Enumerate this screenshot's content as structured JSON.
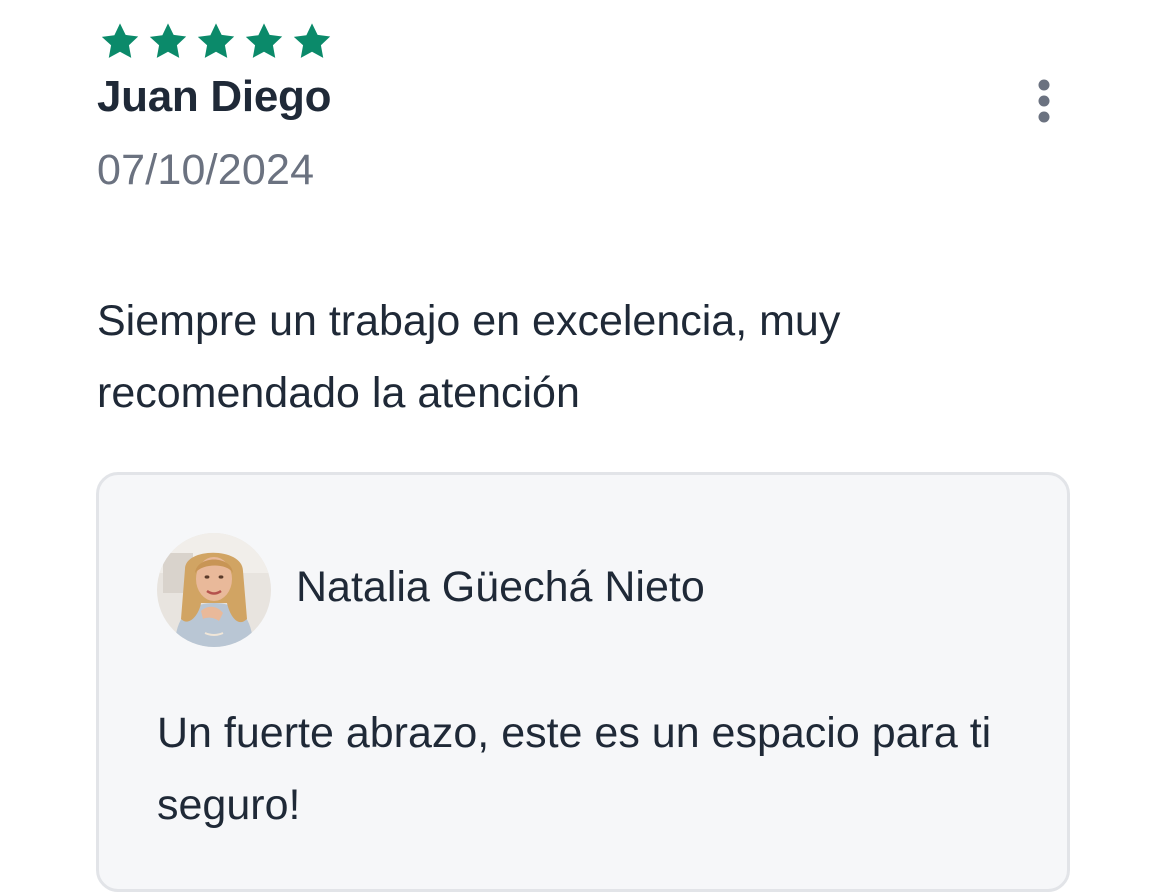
{
  "review": {
    "rating": 5,
    "rating_max": 5,
    "star_color": "#0b8a6a",
    "reviewer_name": "Juan Diego",
    "date": "07/10/2024",
    "text": "Siempre un trabajo en excelencia, muy recomendado la atención",
    "menu_icon": "more-vertical-icon"
  },
  "reply": {
    "responder_name": "Natalia Güechá Nieto",
    "avatar_icon": "profile-photo",
    "text": "Un fuerte abrazo, este es un espacio para ti seguro!"
  }
}
